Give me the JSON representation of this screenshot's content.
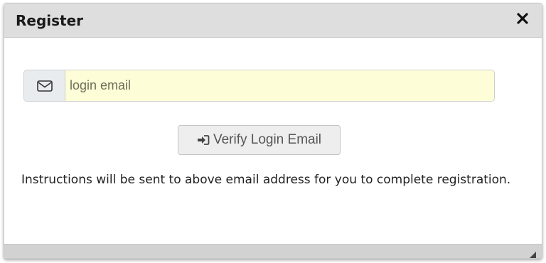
{
  "dialog": {
    "title": "Register",
    "close_icon": "close-icon"
  },
  "email": {
    "icon": "envelope-icon",
    "value": "",
    "placeholder": "login email"
  },
  "verify_button": {
    "icon": "sign-in-icon",
    "label": "Verify Login Email"
  },
  "instructions": "Instructions will be sent to above email address for you to complete registration.",
  "footer": {
    "grip_icon": "resize-grip-icon"
  },
  "colors": {
    "titlebar": "#dedede",
    "input_background": "#fdfdd8",
    "addon_background": "#e9ecef",
    "button_background": "#eeeeee"
  }
}
